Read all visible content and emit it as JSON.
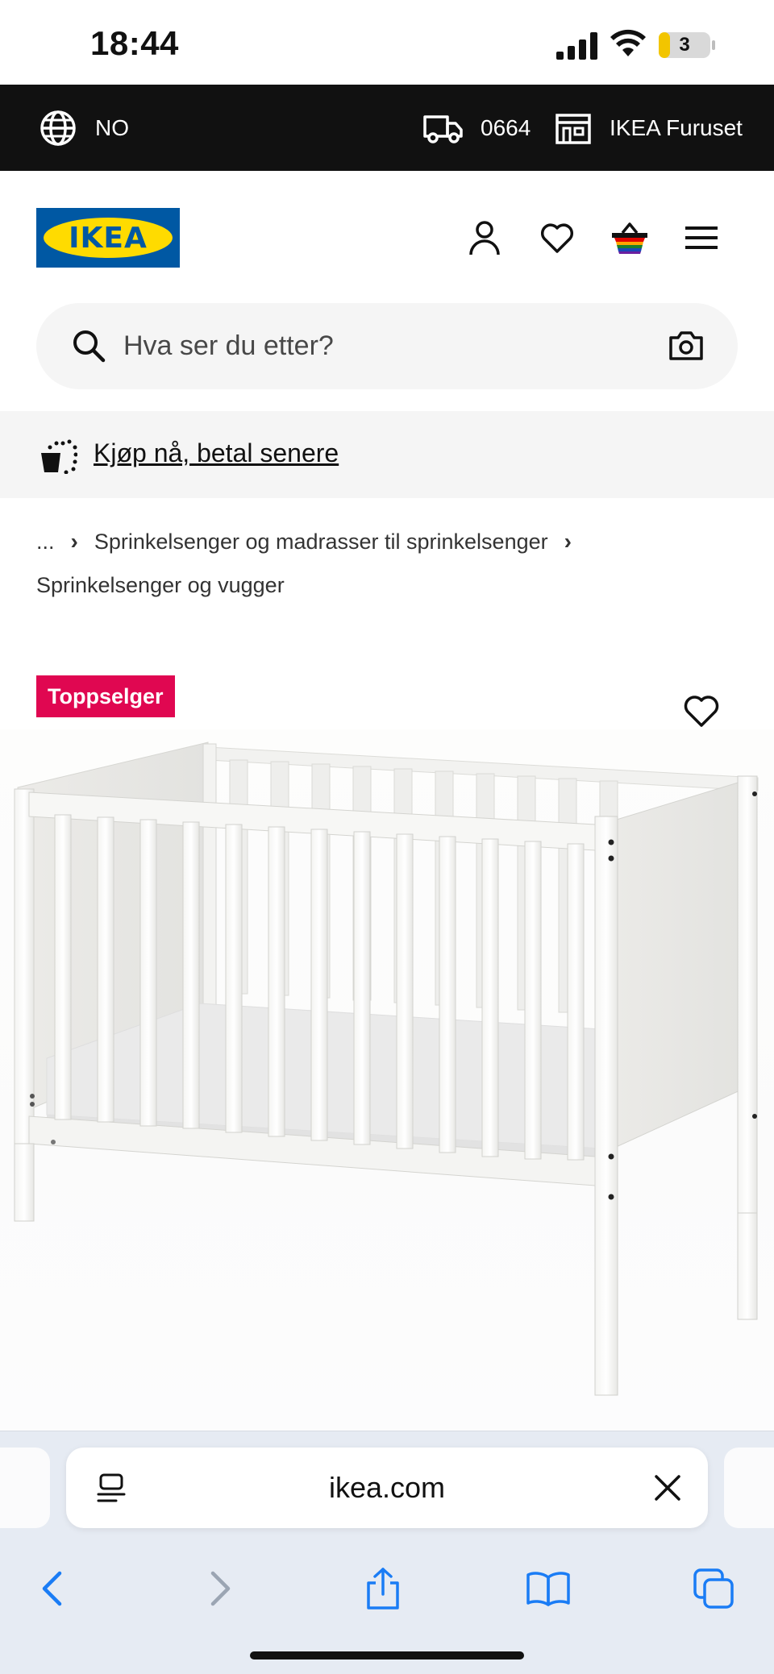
{
  "status_bar": {
    "time": "18:44",
    "battery_level": "3"
  },
  "top_strip": {
    "locale": "NO",
    "postal_code": "0664",
    "store": "IKEA Furuset"
  },
  "header": {
    "logo_text": "IKEA",
    "icons": [
      "user-icon",
      "heart-icon",
      "basket-icon",
      "menu-icon"
    ]
  },
  "search": {
    "placeholder": "Hva ser du etter?"
  },
  "promo": {
    "text": "Kjøp nå, betal senere"
  },
  "breadcrumb": {
    "ellipsis": "...",
    "items": [
      "Sprinkelsenger og madrasser til sprinkelsenger",
      "Sprinkelsenger og vugger"
    ]
  },
  "product": {
    "badge": "Toppselger"
  },
  "safari": {
    "url": "ikea.com"
  },
  "colors": {
    "ikea_blue": "#0058a3",
    "ikea_yellow": "#ffdb00",
    "badge_red": "#e00751",
    "ios_blue": "#1a7cf5"
  }
}
